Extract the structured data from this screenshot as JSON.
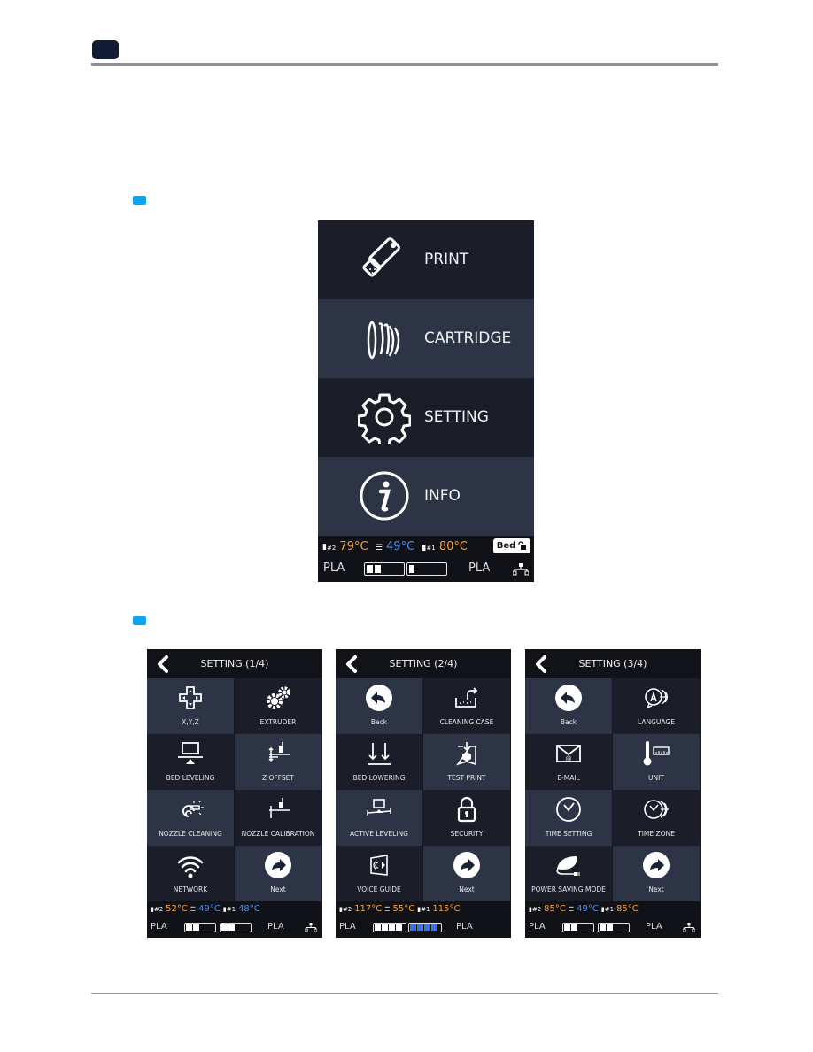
{
  "page": {
    "chapter_badge": "",
    "section_markers": [
      "",
      ""
    ]
  },
  "main_screen": {
    "menu": [
      {
        "label": "PRINT",
        "icon": "usb-drive-icon"
      },
      {
        "label": "CARTRIDGE",
        "icon": "filament-spool-icon"
      },
      {
        "label": "SETTING",
        "icon": "gear-icon"
      },
      {
        "label": "INFO",
        "icon": "info-icon"
      }
    ],
    "status": {
      "nozzle2_label": "#2",
      "nozzle2_temp": "79°C",
      "bed_temp": "49°C",
      "nozzle1_label": "#1",
      "nozzle1_temp": "80°C",
      "bed_lock_label": "Bed",
      "left_material": "PLA",
      "right_material": "PLA",
      "left_cartridge_level": 0.4,
      "right_cartridge_level": 0.2
    }
  },
  "settings_panels": [
    {
      "title": "SETTING (1/4)",
      "tiles": [
        {
          "label": "X,Y,Z",
          "icon": "dpad-icon"
        },
        {
          "label": "EXTRUDER",
          "icon": "gears-icon"
        },
        {
          "label": "BED LEVELING",
          "icon": "bed-leveling-icon"
        },
        {
          "label": "Z OFFSET",
          "icon": "z-offset-icon"
        },
        {
          "label": "NOZZLE CLEANING",
          "icon": "nozzle-cleaning-icon"
        },
        {
          "label": "NOZZLE CALIBRATION",
          "icon": "nozzle-calibration-icon"
        },
        {
          "label": "NETWORK",
          "icon": "wifi-icon"
        },
        {
          "label": "Next",
          "icon": "next-arrow-icon"
        }
      ],
      "status": {
        "n2": "52°C",
        "bed": "49°C",
        "n1": "48°C",
        "n2_color": "orange",
        "n1_color": "blue",
        "left_material": "PLA",
        "right_material": "PLA",
        "left_level": 0.4,
        "right_level": 0.4
      }
    },
    {
      "title": "SETTING (2/4)",
      "tiles": [
        {
          "label": "Back",
          "icon": "back-arrow-icon"
        },
        {
          "label": "CLEANING CASE",
          "icon": "cleaning-case-icon"
        },
        {
          "label": "BED LOWERING",
          "icon": "bed-lowering-icon"
        },
        {
          "label": "TEST PRINT",
          "icon": "test-print-icon"
        },
        {
          "label": "ACTIVE LEVELING",
          "icon": "active-leveling-icon"
        },
        {
          "label": "SECURITY",
          "icon": "lock-icon"
        },
        {
          "label": "VOICE GUIDE",
          "icon": "voice-guide-icon"
        },
        {
          "label": "Next",
          "icon": "next-arrow-icon"
        }
      ],
      "status": {
        "n2": "117°C",
        "bed": "55°C",
        "n1": "115°C",
        "n2_color": "orange",
        "n1_color": "orange",
        "left_material": "PLA",
        "right_material": "PLA",
        "left_level": 1.0,
        "right_level": 1.0
      }
    },
    {
      "title": "SETTING (3/4)",
      "tiles": [
        {
          "label": "Back",
          "icon": "back-arrow-icon"
        },
        {
          "label": "LANGUAGE",
          "icon": "language-icon"
        },
        {
          "label": "E-MAIL",
          "icon": "email-icon"
        },
        {
          "label": "UNIT",
          "icon": "unit-icon"
        },
        {
          "label": "TIME SETTING",
          "icon": "clock-icon"
        },
        {
          "label": "TIME ZONE",
          "icon": "time-zone-icon"
        },
        {
          "label": "POWER SAVING MODE",
          "icon": "power-saving-icon"
        },
        {
          "label": "Next",
          "icon": "next-arrow-icon"
        }
      ],
      "status": {
        "n2": "85°C",
        "bed": "49°C",
        "n1": "85°C",
        "n2_color": "orange",
        "n1_color": "orange",
        "left_material": "PLA",
        "right_material": "PLA",
        "left_level": 0.4,
        "right_level": 0.4
      }
    }
  ],
  "colors": {
    "accent_marker": "#11a4ec",
    "temp_hot": "#f2a23a",
    "temp_cool": "#4a8ee8",
    "tile_light": "#2c3446",
    "tile_dark": "#1b1d29"
  }
}
